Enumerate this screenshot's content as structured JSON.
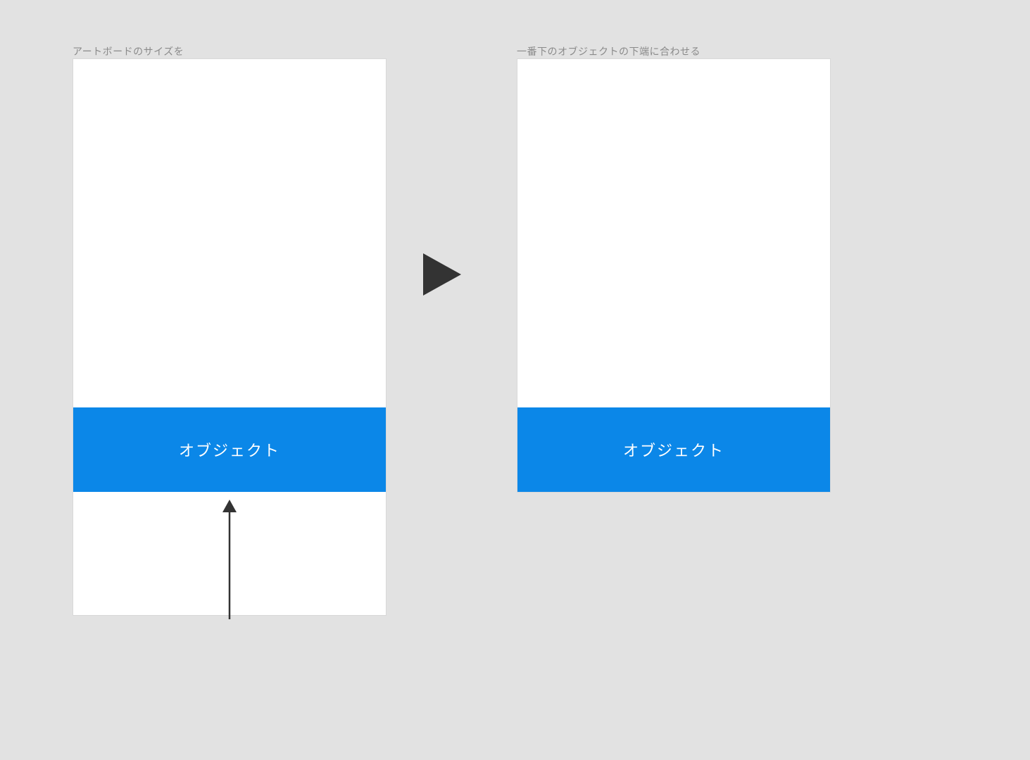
{
  "labels": {
    "left": "アートボードのサイズを",
    "right": "一番下のオブジェクトの下端に合わせる"
  },
  "object": {
    "label": "オブジェクト"
  }
}
